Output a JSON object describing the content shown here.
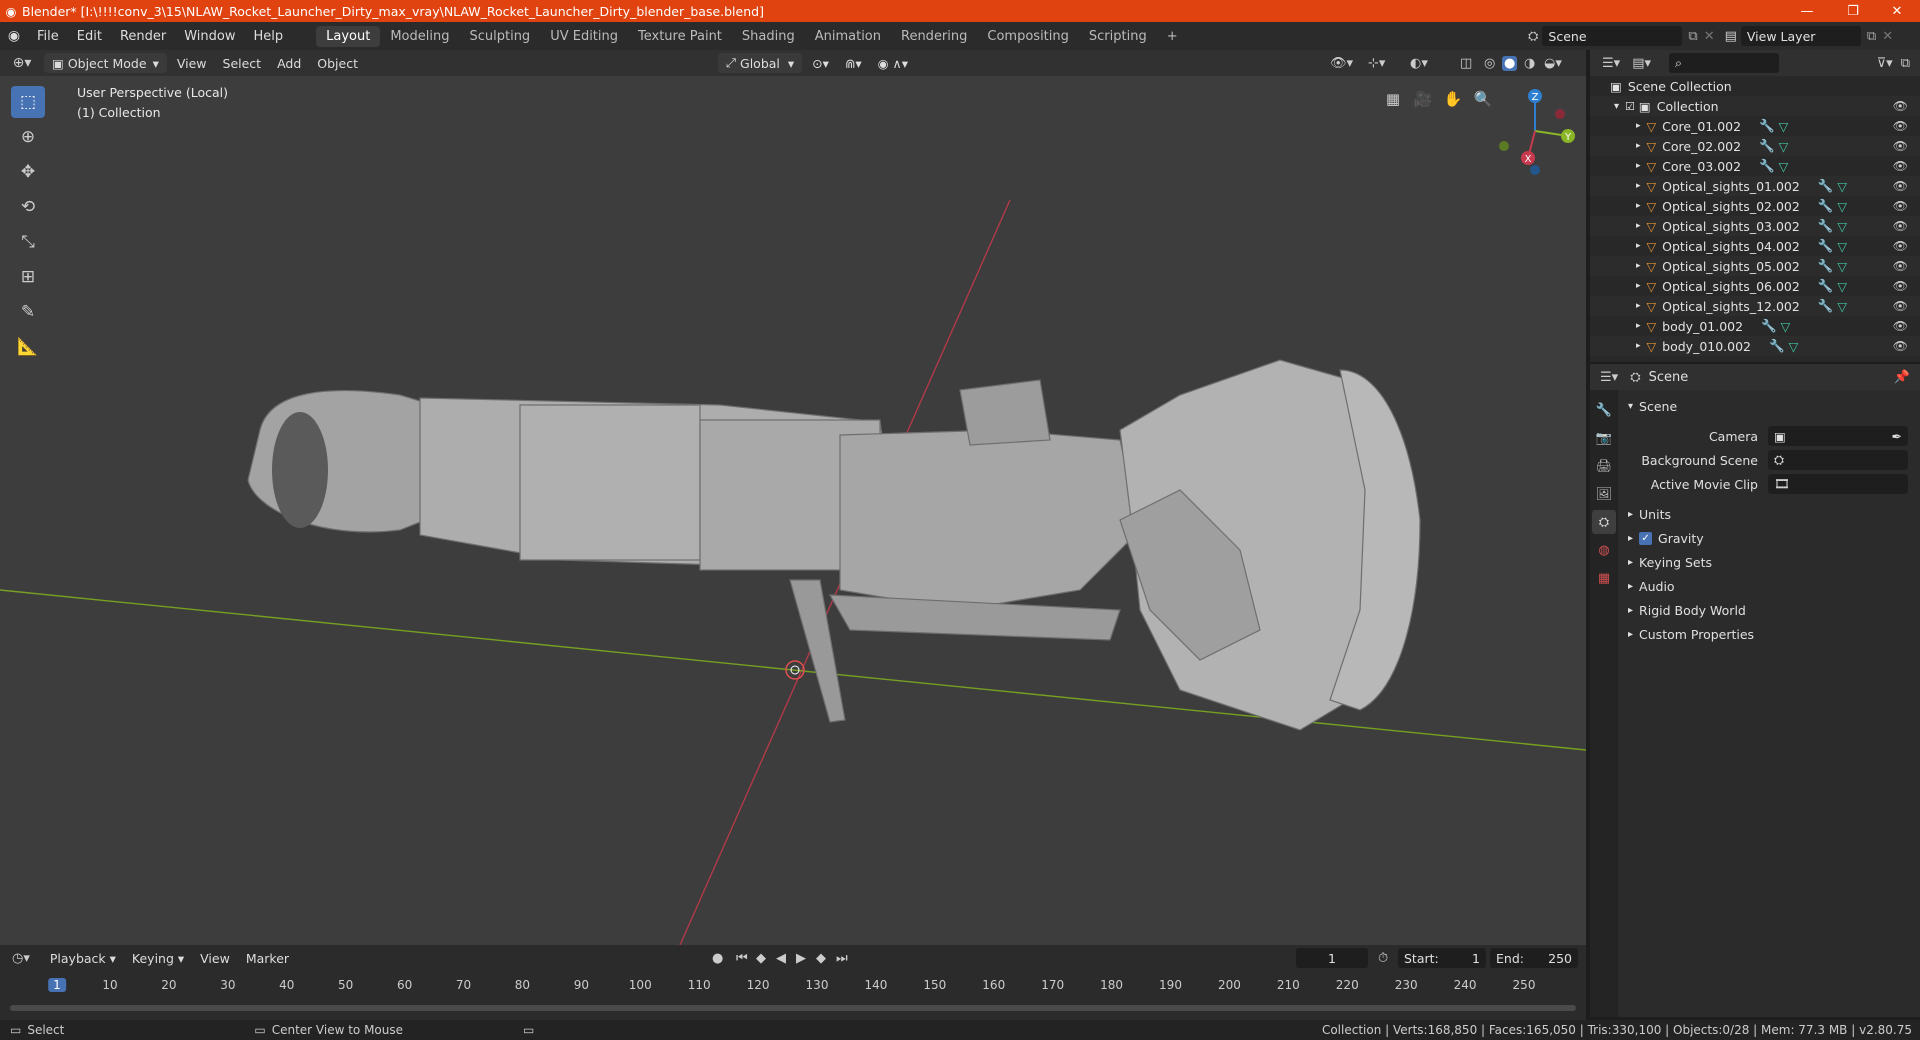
{
  "window": {
    "title": "Blender* [I:\\!!!!conv_3\\15\\NLAW_Rocket_Launcher_Dirty_max_vray\\NLAW_Rocket_Launcher_Dirty_blender_base.blend]",
    "min": "—",
    "restore": "❐",
    "close": "✕"
  },
  "menus": [
    "File",
    "Edit",
    "Render",
    "Window",
    "Help"
  ],
  "workspaces": [
    "Layout",
    "Modeling",
    "Sculpting",
    "UV Editing",
    "Texture Paint",
    "Shading",
    "Animation",
    "Rendering",
    "Compositing",
    "Scripting"
  ],
  "add_workspace": "+",
  "scene_field": "Scene",
  "view_layer_field": "View Layer",
  "viewport": {
    "mode": "Object Mode",
    "menus": [
      "View",
      "Select",
      "Add",
      "Object"
    ],
    "transform": "Global",
    "info_line1": "User Perspective (Local)",
    "info_line2": "(1) Collection",
    "gizmo": {
      "x": "X",
      "y": "Y",
      "z": "Z"
    }
  },
  "outliner": {
    "root": "Scene Collection",
    "collection": "Collection",
    "items": [
      "Core_01.002",
      "Core_02.002",
      "Core_03.002",
      "Optical_sights_01.002",
      "Optical_sights_02.002",
      "Optical_sights_03.002",
      "Optical_sights_04.002",
      "Optical_sights_05.002",
      "Optical_sights_06.002",
      "Optical_sights_12.002",
      "body_01.002",
      "body_010.002"
    ]
  },
  "properties": {
    "header": "Scene",
    "panel": "Scene",
    "camera_label": "Camera",
    "bg_scene_label": "Background Scene",
    "movie_clip_label": "Active Movie Clip",
    "sections": [
      "Units",
      "Gravity",
      "Keying Sets",
      "Audio",
      "Rigid Body World",
      "Custom Properties"
    ]
  },
  "timeline": {
    "menus": [
      "Playback",
      "Keying",
      "View",
      "Marker"
    ],
    "current_frame": "1",
    "start_label": "Start:",
    "start": "1",
    "end_label": "End:",
    "end": "250",
    "ticks": [
      "1",
      "10",
      "20",
      "30",
      "40",
      "50",
      "60",
      "70",
      "80",
      "90",
      "100",
      "110",
      "120",
      "130",
      "140",
      "150",
      "160",
      "170",
      "180",
      "190",
      "200",
      "210",
      "220",
      "230",
      "240",
      "250"
    ]
  },
  "status": {
    "select": "Select",
    "center_view": "Center View to Mouse",
    "stats": "Collection | Verts:168,850 | Faces:165,050 | Tris:330,100 | Objects:0/28 | Mem: 77.3 MB | v2.80.75"
  },
  "colors": {
    "title_bar": "#e0430f",
    "accent": "#4772b3",
    "x_axis": "#c8394e",
    "y_axis": "#8ab526",
    "z_axis": "#2f7fd0",
    "object_icon": "#e0932e",
    "mesh_icon": "#41c6a5"
  }
}
